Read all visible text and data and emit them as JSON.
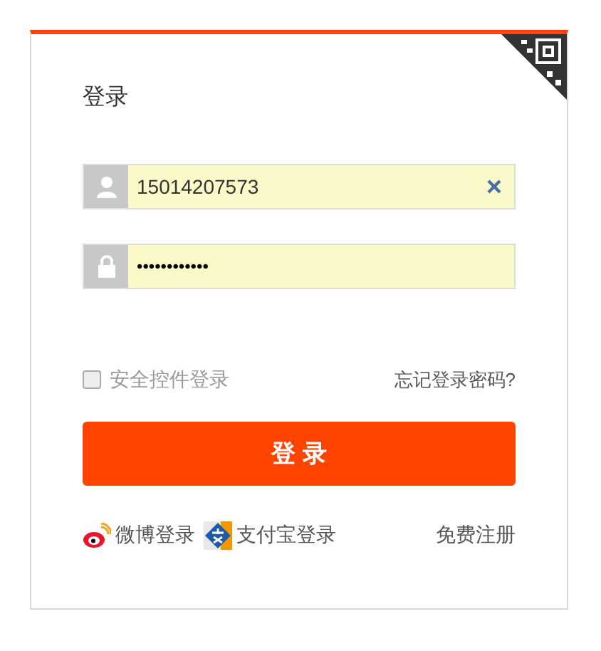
{
  "title": "登录",
  "username": {
    "value": "15014207573"
  },
  "password": {
    "value": "••••••••••••"
  },
  "secure_login": {
    "label": "安全控件登录",
    "checked": false
  },
  "forgot_link": "忘记登录密码?",
  "submit": "登 录",
  "footer": [
    {
      "kind": "weibo",
      "label": "微博登录"
    },
    {
      "kind": "alipay",
      "label": "支付宝登录"
    }
  ],
  "register_link": "免费注册"
}
